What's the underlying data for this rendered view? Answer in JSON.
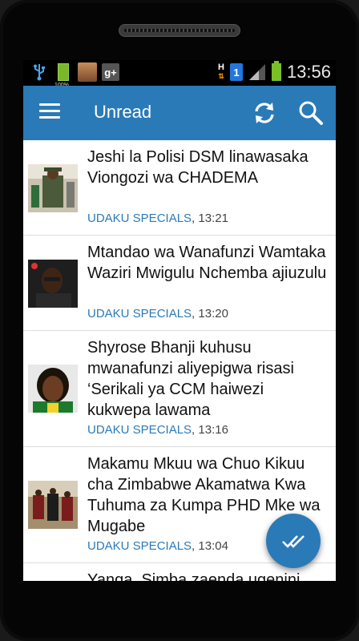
{
  "statusbar": {
    "usb_icon": "usb-icon",
    "battery_percent": "100%",
    "gplus_label": "g+",
    "network_label": "H",
    "sim_label": "1",
    "time": "13:56"
  },
  "appbar": {
    "title": "Unread",
    "menu_icon": "hamburger-menu-icon",
    "refresh_icon": "refresh-icon",
    "search_icon": "search-icon",
    "color": "#2a7ab8"
  },
  "articles": [
    {
      "headline": "Jeshi la Polisi DSM linawasaka Viongozi wa CHADEMA",
      "source": "UDAKU SPECIALS",
      "time": ", 13:21"
    },
    {
      "headline": "Mtandao wa Wanafunzi Wamtaka Waziri Mwigulu Nchemba ajiuzulu",
      "source": "UDAKU SPECIALS",
      "time": ", 13:20"
    },
    {
      "headline": "Shyrose Bhanji kuhusu mwanafunzi aliyepigwa risasi ‘Serikali ya CCM haiwezi kukwepa lawama",
      "source": "UDAKU SPECIALS",
      "time": ", 13:16"
    },
    {
      "headline": "Makamu Mkuu wa Chuo Kikuu cha Zimbabwe Akamatwa Kwa Tuhuma za Kumpa PHD Mke wa Mugabe",
      "source": "UDAKU SPECIALS",
      "time": ", 13:04"
    },
    {
      "headline": "Yanga, Simba zaenda ugenini",
      "source": "",
      "time": ""
    }
  ],
  "fab": {
    "icon": "double-check-icon"
  }
}
